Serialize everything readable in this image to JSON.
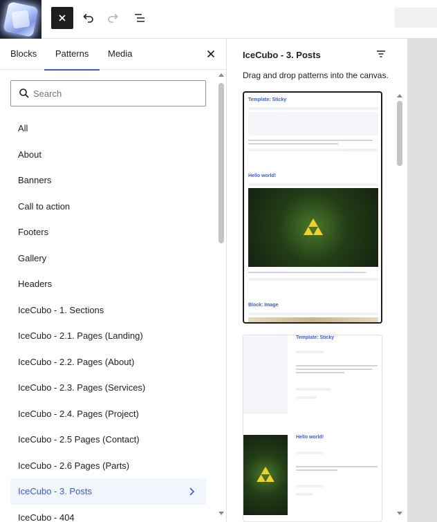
{
  "toolbar": {
    "site_icon": "ice-cube-site-icon",
    "close_icon": "close-icon",
    "undo_icon": "undo-icon",
    "redo_icon": "redo-icon",
    "list_view_icon": "list-view-icon"
  },
  "inserter": {
    "tabs": [
      {
        "label": "Blocks",
        "selected": false
      },
      {
        "label": "Patterns",
        "selected": true
      },
      {
        "label": "Media",
        "selected": false
      }
    ],
    "close_icon": "close-icon",
    "search": {
      "placeholder": "Search",
      "value": ""
    },
    "categories": [
      {
        "label": "All"
      },
      {
        "label": "About"
      },
      {
        "label": "Banners"
      },
      {
        "label": "Call to action"
      },
      {
        "label": "Footers"
      },
      {
        "label": "Gallery"
      },
      {
        "label": "Headers"
      },
      {
        "label": "IceCubo - 1. Sections"
      },
      {
        "label": "IceCubo - 2.1. Pages (Landing)"
      },
      {
        "label": "IceCubo - 2.2. Pages (About)"
      },
      {
        "label": "IceCubo - 2.3. Pages (Services)"
      },
      {
        "label": "IceCubo - 2.4. Pages (Project)"
      },
      {
        "label": "IceCubo - 2.5 Pages (Contact)"
      },
      {
        "label": "IceCubo - 2.6 Pages (Parts)"
      },
      {
        "label": "IceCubo - 3. Posts",
        "active": true
      },
      {
        "label": "IceCubo - 404"
      }
    ]
  },
  "patterns_panel": {
    "title": "IceCubo - 3. Posts",
    "description": "Drag and drop patterns into the canvas.",
    "filter_icon": "filter-icon",
    "card1": {
      "sections": [
        {
          "heading": "Template: Sticky"
        },
        {
          "heading": "Hello world!"
        },
        {
          "heading": "Block: Image"
        }
      ]
    },
    "card2": {
      "sections": [
        {
          "heading": "Template: Sticky"
        },
        {
          "heading": "Hello world!"
        }
      ]
    }
  },
  "colors": {
    "accent": "#3858e9",
    "dark": "#1e1e1e",
    "active_bg": "#f0f6fc"
  }
}
